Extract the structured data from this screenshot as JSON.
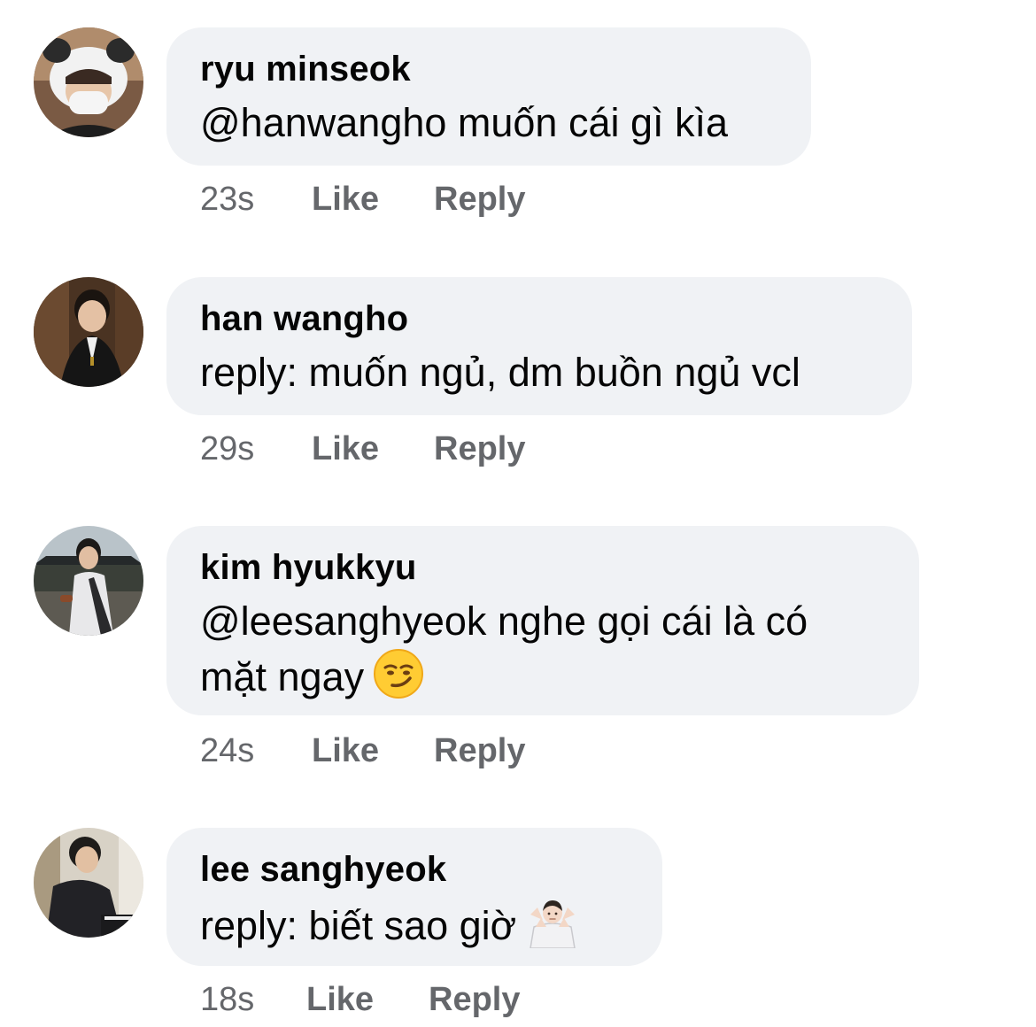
{
  "comments": [
    {
      "author": "ryu minseok",
      "text": "@hanwangho muốn cái gì kìa",
      "text_line2": "",
      "time": "23s",
      "like_label": "Like",
      "reply_label": "Reply",
      "emoji": ""
    },
    {
      "author": "han wangho",
      "text": "reply: muốn ngủ, dm buồn ngủ vcl",
      "text_line2": "",
      "time": "29s",
      "like_label": "Like",
      "reply_label": "Reply",
      "emoji": ""
    },
    {
      "author": "kim hyukkyu",
      "text": "@leesanghyeok nghe gọi cái là có",
      "text_line2": "mặt ngay",
      "time": "24s",
      "like_label": "Like",
      "reply_label": "Reply",
      "emoji": "smirking-face-icon"
    },
    {
      "author": "lee sanghyeok",
      "text": "reply: biết sao giờ",
      "text_line2": "",
      "time": "18s",
      "like_label": "Like",
      "reply_label": "Reply",
      "emoji": "person-shrugging-icon"
    }
  ],
  "colors": {
    "bubble": "#f0f2f5",
    "meta_text": "#65676b",
    "name_text": "#050505"
  }
}
